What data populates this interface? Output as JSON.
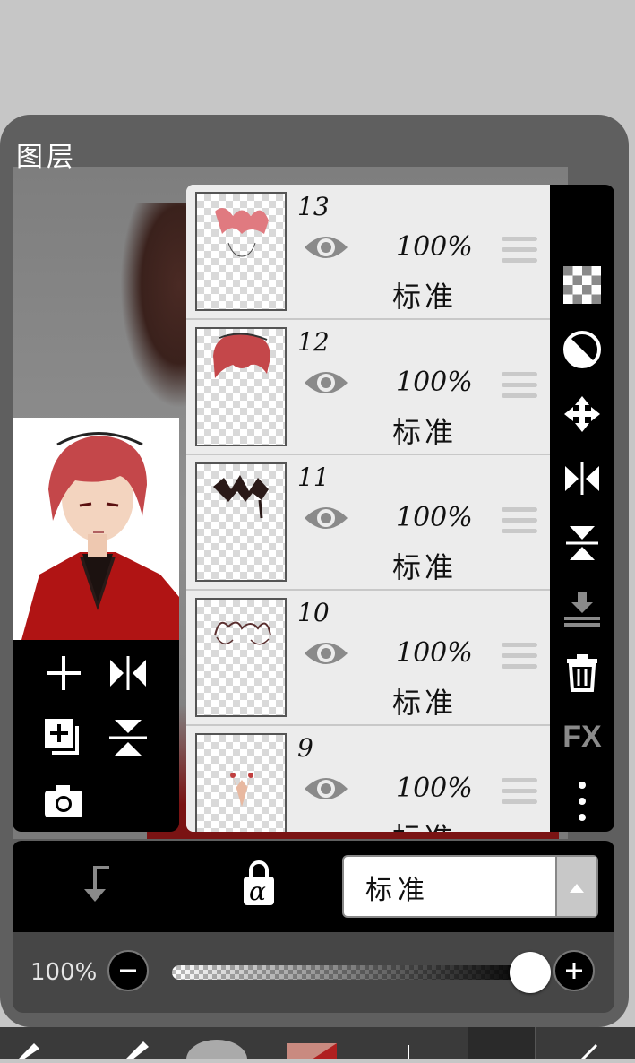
{
  "panel": {
    "title": "图层"
  },
  "layers": [
    {
      "num": "13",
      "opacity": "100%",
      "blend": "标准"
    },
    {
      "num": "12",
      "opacity": "100%",
      "blend": "标准"
    },
    {
      "num": "11",
      "opacity": "100%",
      "blend": "标准"
    },
    {
      "num": "10",
      "opacity": "100%",
      "blend": "标准"
    },
    {
      "num": "9",
      "opacity": "100%",
      "blend": "标准"
    }
  ],
  "right_toolbar": {
    "icons": [
      "transparency-icon",
      "invert-icon",
      "move-icon",
      "flip-horizontal-icon",
      "flip-vertical-icon",
      "merge-down-icon",
      "trash-icon",
      "fx-icon",
      "more-icon"
    ],
    "fx_label": "FX"
  },
  "left_toolbar": {
    "icons": [
      "add-layer-icon",
      "flip-horizontal-icon",
      "duplicate-layer-icon",
      "flip-vertical-icon",
      "camera-icon"
    ]
  },
  "bottom_bar": {
    "clip_icon": "clipping-icon",
    "alpha_lock_label": "α",
    "blend_mode": "标准"
  },
  "opacity_control": {
    "label": "100%",
    "value": 1.0
  },
  "colors": {
    "panel_bg": "#5f5f5f",
    "toolbar_bg": "#000000",
    "list_bg": "#ececec"
  }
}
